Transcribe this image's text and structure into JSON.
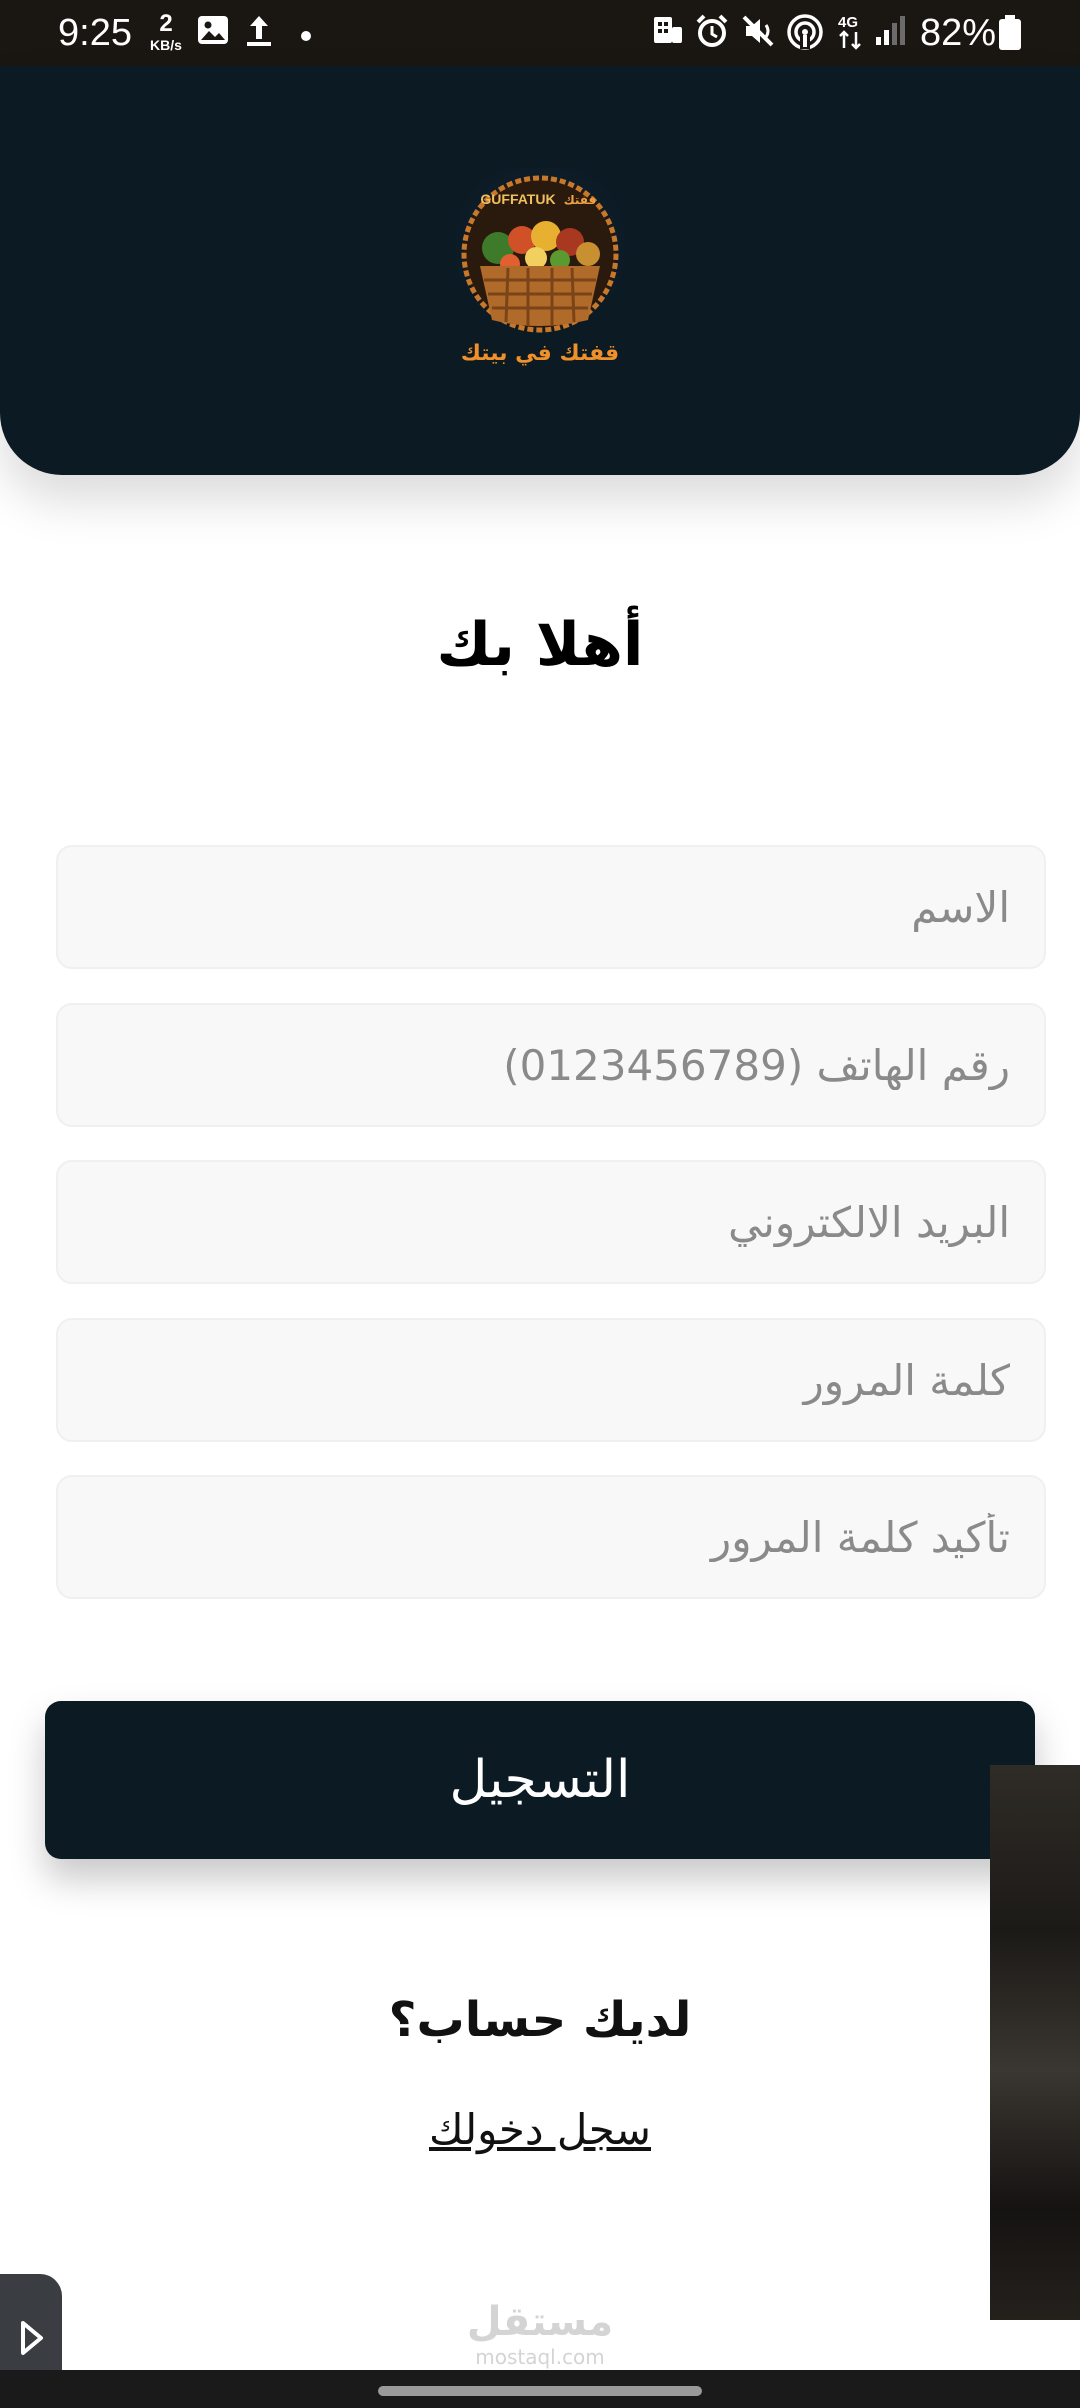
{
  "status_bar": {
    "time": "9:25",
    "data_rate_value": "2",
    "data_rate_unit": "KB/s",
    "network": "4G",
    "battery": "82%",
    "icons": [
      "gallery-icon",
      "upload-icon",
      "dot-icon",
      "hotspot-icon",
      "alarm-icon",
      "mute-icon",
      "wifi-call-icon",
      "network-4g-icon",
      "signal-icon",
      "battery-icon"
    ]
  },
  "header": {
    "logo_text_en": "GUFFATUK",
    "logo_text_ar": "قفتك",
    "logo_tagline": "قفتك في بيتك",
    "background_color": "#0c1a24"
  },
  "welcome_title": "أهلا بك",
  "form": {
    "name_placeholder": "الاسم",
    "phone_placeholder": "رقم الهاتف (0123456789)",
    "email_placeholder": "البريد الالكتروني",
    "password_placeholder": "كلمة المرور",
    "confirm_password_placeholder": "تأكيد كلمة المرور"
  },
  "register_button": "التسجيل",
  "have_account_text": "لديك حساب؟",
  "login_link": "سجل دخولك",
  "watermark": {
    "arabic": "مستقل",
    "url": "mostaql.com"
  },
  "colors": {
    "primary": "#0c1a24",
    "input_background": "#f8f8f8",
    "placeholder": "#8a8a8a"
  }
}
